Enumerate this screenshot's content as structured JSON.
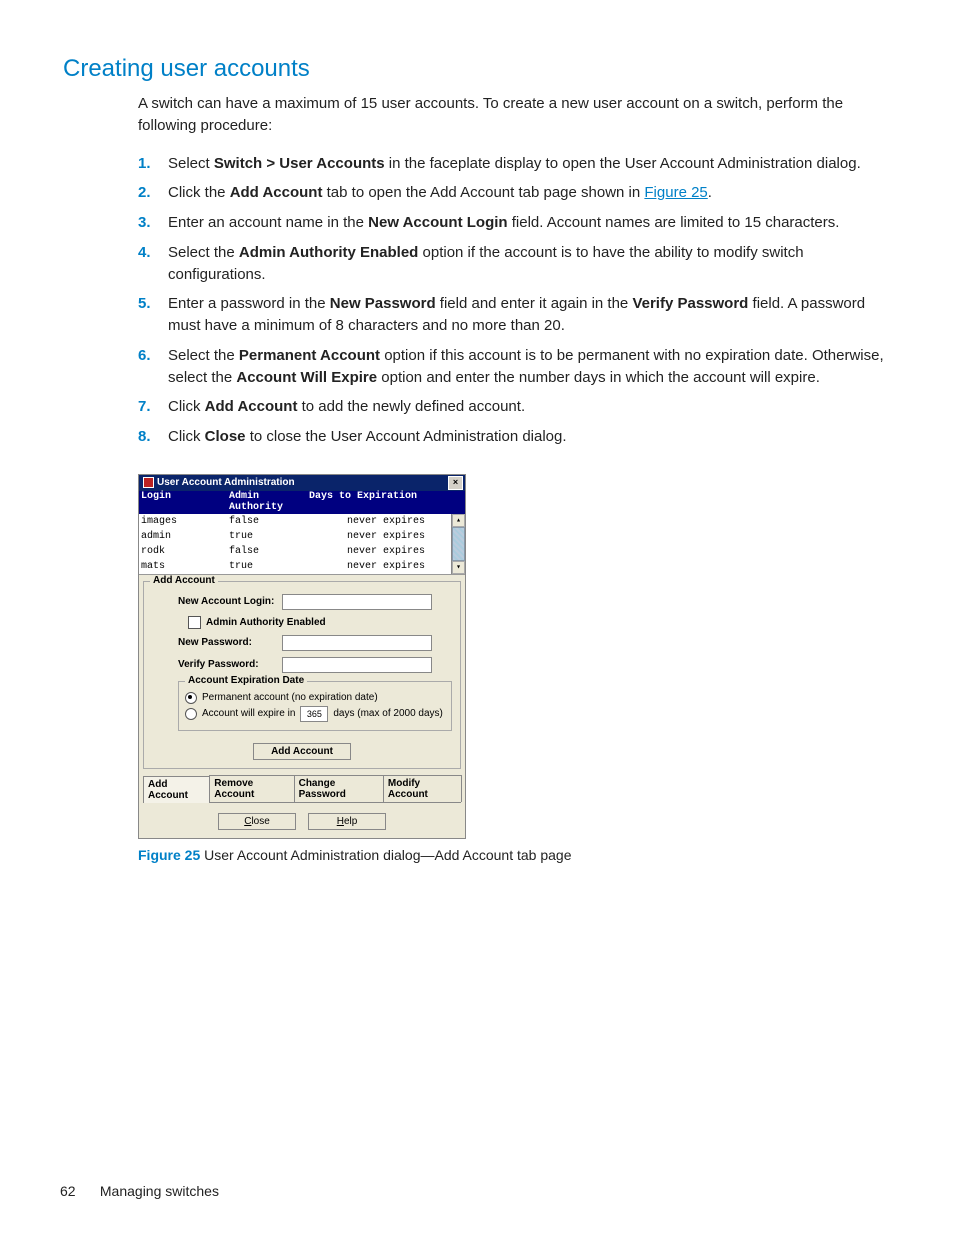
{
  "heading": "Creating user accounts",
  "intro": "A switch can have a maximum of 15 user accounts. To create a new user account on a switch, perform the following procedure:",
  "steps": [
    {
      "pre": "Select ",
      "bold": "Switch > User Accounts",
      "post": " in the faceplate display to open the User Account Administration dialog."
    },
    {
      "pre": "Click the ",
      "bold": "Add Account",
      "post": " tab to open the Add Account tab page shown in ",
      "link": "Figure 25",
      "tail": "."
    },
    {
      "pre": "Enter an account name in the ",
      "bold": "New Account Login",
      "post": " field. Account names are limited to 15 characters."
    },
    {
      "pre": "Select the ",
      "bold": "Admin Authority Enabled",
      "post": " option if the account is to have the ability to modify switch configurations."
    },
    {
      "pre": "Enter a password in the ",
      "bold": "New Password",
      "mid": " field and enter it again in the ",
      "bold2": "Verify Password",
      "post": " field. A password must have a minimum of 8 characters and no more than 20."
    },
    {
      "pre": "Select the ",
      "bold": "Permanent Account",
      "mid": " option if this account is to be permanent with no expiration date. Otherwise, select the ",
      "bold2": "Account Will Expire",
      "post": " option and enter the number days in which the account will expire."
    },
    {
      "pre": "Click ",
      "bold": "Add Account",
      "post": " to add the newly defined account."
    },
    {
      "pre": "Click ",
      "bold": "Close",
      "post": " to close the User Account Administration dialog."
    }
  ],
  "dialog": {
    "title": "User Account Administration",
    "columns": {
      "login": "Login",
      "auth": "Admin Authority",
      "exp": "Days to Expiration"
    },
    "rows": [
      {
        "login": "images",
        "auth": "false",
        "exp": "never expires"
      },
      {
        "login": "admin",
        "auth": "true",
        "exp": "never expires"
      },
      {
        "login": "rodk",
        "auth": "false",
        "exp": "never expires"
      },
      {
        "login": "mats",
        "auth": "true",
        "exp": "never expires"
      }
    ],
    "addAccount": {
      "legend": "Add Account",
      "newLoginLabel": "New Account Login:",
      "adminAuthLabel": "Admin Authority Enabled",
      "newPasswordLabel": "New Password:",
      "verifyPasswordLabel": "Verify Password:",
      "expiration": {
        "legend": "Account Expiration Date",
        "permanentLabel": "Permanent account (no expiration date)",
        "expirePre": "Account will expire in",
        "daysValue": "365",
        "expirePost": "days (max of 2000 days)"
      },
      "addButton": "Add Account"
    },
    "tabs": [
      "Add Account",
      "Remove Account",
      "Change Password",
      "Modify Account"
    ],
    "activeTab": 0,
    "bottomButtons": {
      "close": "Close",
      "help": "Help"
    }
  },
  "caption": {
    "label": "Figure 25",
    "text": " User Account Administration dialog—Add Account tab page"
  },
  "footer": {
    "page": "62",
    "section": "Managing switches"
  }
}
